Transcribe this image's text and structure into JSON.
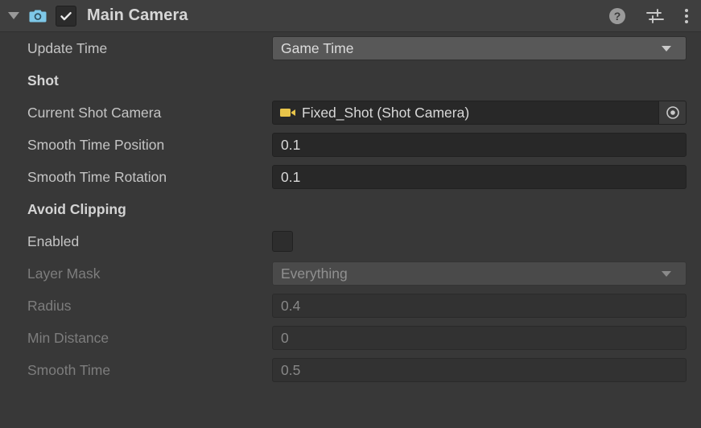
{
  "header": {
    "foldout_icon": "chevron-down-icon",
    "component_icon": "camera-icon",
    "enabled_checked": true,
    "title": "Main Camera",
    "help_icon": "help-icon",
    "preset_icon": "preset-sliders-icon",
    "menu_icon": "more-vertical-icon"
  },
  "rows": [
    {
      "name": "update-time",
      "label": "Update Time",
      "control": "popup",
      "value": "Game Time",
      "disabled": false
    },
    {
      "name": "shot-section",
      "label": "Shot",
      "control": "section"
    },
    {
      "name": "current-shot-camera",
      "label": "Current Shot Camera",
      "control": "object",
      "value": "Fixed_Shot (Shot Camera)",
      "object_icon": "video-camera-icon",
      "picker_icon": "object-picker-icon",
      "disabled": false
    },
    {
      "name": "smooth-time-position",
      "label": "Smooth Time Position",
      "control": "field",
      "value": "0.1",
      "disabled": false
    },
    {
      "name": "smooth-time-rotation",
      "label": "Smooth Time Rotation",
      "control": "field",
      "value": "0.1",
      "disabled": false
    },
    {
      "name": "avoid-clipping-section",
      "label": "Avoid Clipping",
      "control": "section"
    },
    {
      "name": "enabled",
      "label": "Enabled",
      "control": "checkbox",
      "checked": false,
      "disabled": false
    },
    {
      "name": "layer-mask",
      "label": "Layer Mask",
      "control": "popup",
      "value": "Everything",
      "disabled": true
    },
    {
      "name": "radius",
      "label": "Radius",
      "control": "field",
      "value": "0.4",
      "disabled": true
    },
    {
      "name": "min-distance",
      "label": "Min Distance",
      "control": "field",
      "value": "0",
      "disabled": true
    },
    {
      "name": "smooth-time",
      "label": "Smooth Time",
      "control": "field",
      "value": "0.5",
      "disabled": true
    }
  ],
  "colors": {
    "panel_bg": "#383838",
    "header_bg": "#3f3f3f",
    "popup_bg": "#585858",
    "field_bg": "#282828",
    "component_icon": "#7ec8e8",
    "object_icon": "#e8c44a",
    "label_text": "#c4c4c4",
    "label_text_disabled": "#7d7d7d"
  }
}
